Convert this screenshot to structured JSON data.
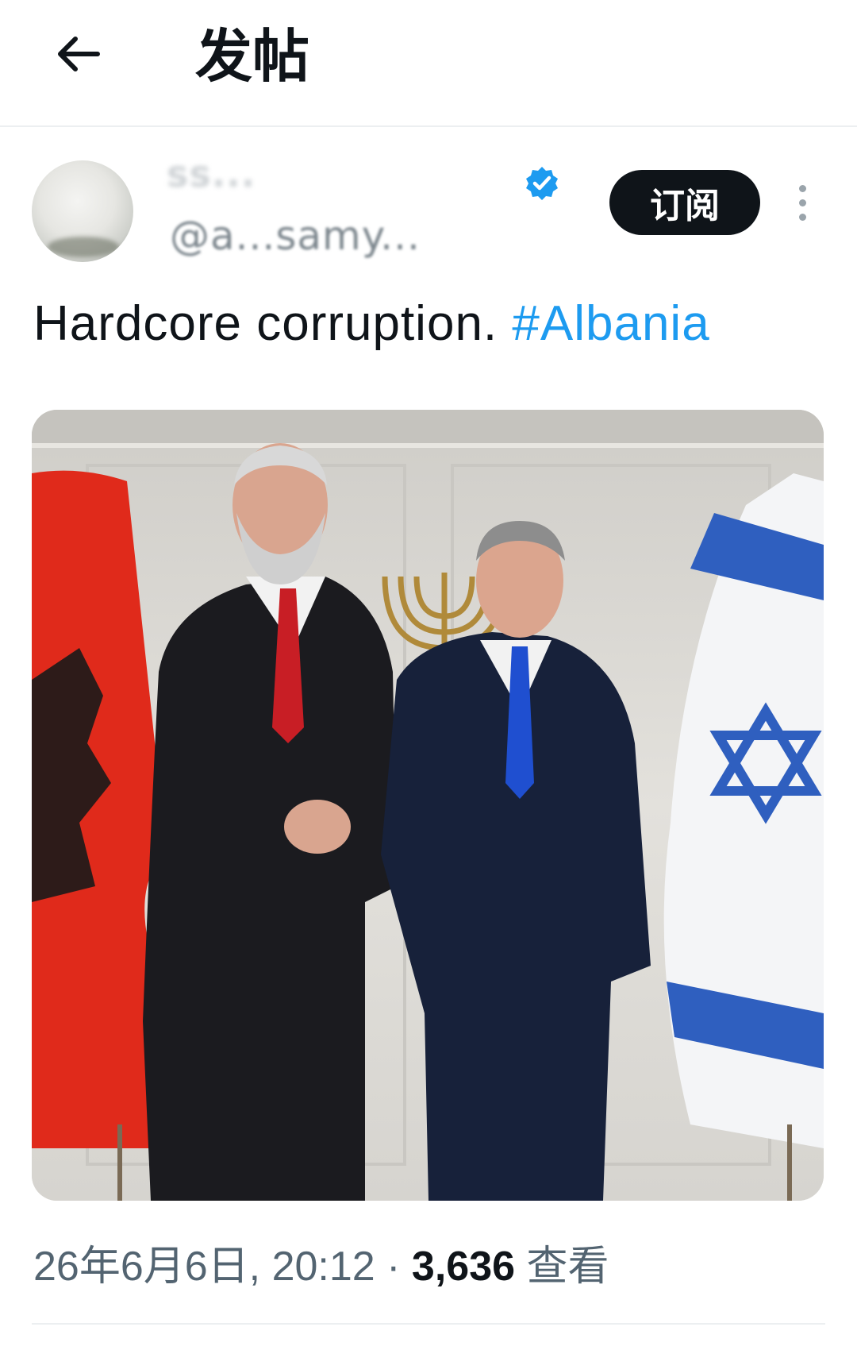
{
  "header": {
    "title": "发帖",
    "back_icon": "arrow-left-icon"
  },
  "author": {
    "display_name": "ss...",
    "handle": "@a...samy...",
    "verified_color": "#1d9bf0",
    "subscribe_label": "订阅"
  },
  "tweet": {
    "text": "Hardcore corruption. ",
    "hashtag": "#Albania"
  },
  "media": {
    "type": "photo"
  },
  "meta": {
    "timestamp": "26年6月6日, 20:12",
    "separator": " · ",
    "views_count": "3,636",
    "views_label": " 查看"
  },
  "colors": {
    "accent": "#1d9bf0",
    "text": "#0f1419",
    "muted": "#536471"
  }
}
